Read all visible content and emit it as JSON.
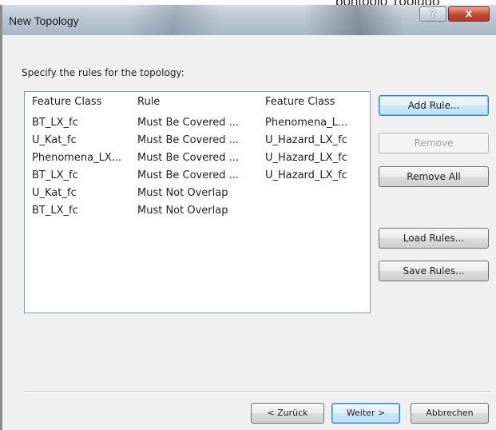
{
  "background_text": "pontoolo 1ooluuo",
  "window": {
    "title": "New Topology",
    "help_label": "?",
    "close_label": "x"
  },
  "instruction": "Specify the rules for the topology:",
  "table": {
    "headers": [
      "Feature Class",
      "Rule",
      "Feature Class"
    ],
    "rows": [
      [
        "BT_LX_fc",
        "Must Be Covered ...",
        "Phenomena_L..."
      ],
      [
        "U_Kat_fc",
        "Must Be Covered ...",
        "U_Hazard_LX_fc"
      ],
      [
        "Phenomena_LX...",
        "Must Be Covered ...",
        "U_Hazard_LX_fc"
      ],
      [
        "BT_LX_fc",
        "Must Be Covered ...",
        "U_Hazard_LX_fc"
      ],
      [
        "U_Kat_fc",
        "Must Not Overlap",
        ""
      ],
      [
        "BT_LX_fc",
        "Must Not Overlap",
        ""
      ]
    ]
  },
  "side_buttons": {
    "add_rule": "Add Rule...",
    "remove": "Remove",
    "remove_all": "Remove All",
    "load_rules": "Load Rules...",
    "save_rules": "Save Rules..."
  },
  "nav_buttons": {
    "back": "< Zurück",
    "next": "Weiter >",
    "cancel": "Abbrechen"
  }
}
